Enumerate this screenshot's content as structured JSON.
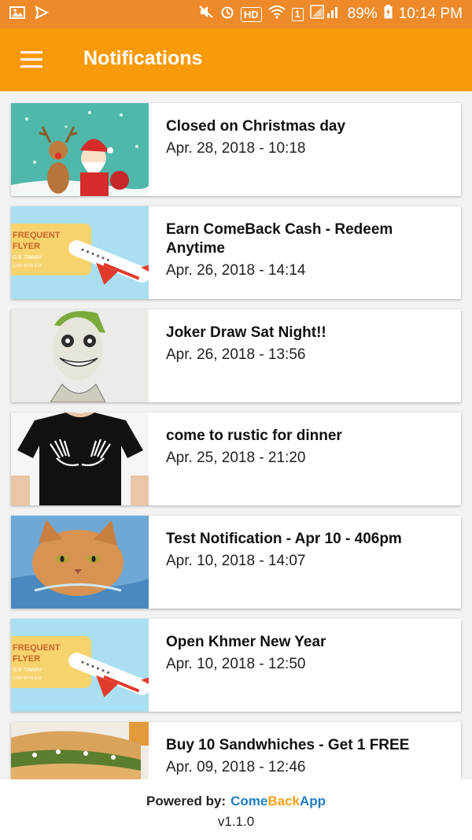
{
  "status_bar": {
    "hd_label": "HD",
    "sim_label": "1",
    "battery": "89%",
    "time": "10:14 PM"
  },
  "app_bar": {
    "title": "Notifications",
    "background": "#f99a0b"
  },
  "notifications": [
    {
      "title": "Closed on Christmas day",
      "date": "Apr. 28, 2018 - 10:18",
      "image": "christmas-santa-reindeer"
    },
    {
      "title": "Earn ComeBack Cash - Redeem Anytime",
      "date": "Apr. 26, 2018 - 14:14",
      "image": "frequent-flyer-card"
    },
    {
      "title": "Joker Draw Sat Night!!",
      "date": "Apr. 26, 2018 - 13:56",
      "image": "joker-drawing"
    },
    {
      "title": "come to rustic for dinner",
      "date": "Apr. 25, 2018 - 21:20",
      "image": "skeleton-hands-tshirt"
    },
    {
      "title": "Test Notification - Apr 10 - 406pm",
      "date": "Apr. 10, 2018 - 14:07",
      "image": "grumpy-cat-in-water"
    },
    {
      "title": "Open Khmer New Year",
      "date": "Apr. 10, 2018 - 12:50",
      "image": "frequent-flyer-card"
    },
    {
      "title": "Buy 10 Sandwhiches - Get 1 FREE",
      "date": "Apr. 09, 2018 - 12:46",
      "image": "sandwich"
    }
  ],
  "thumb_text": {
    "flyer_line1": "FREQUENT",
    "flyer_line2": "FLYER",
    "flyer_line3": "G.E.TAWAY",
    "flyer_line4": "1234 5678 912"
  },
  "footer": {
    "powered_label": "Powered by:",
    "brand_part1": "Come",
    "brand_part2": "Back",
    "brand_part3": "App",
    "version": "v1.1.0"
  }
}
